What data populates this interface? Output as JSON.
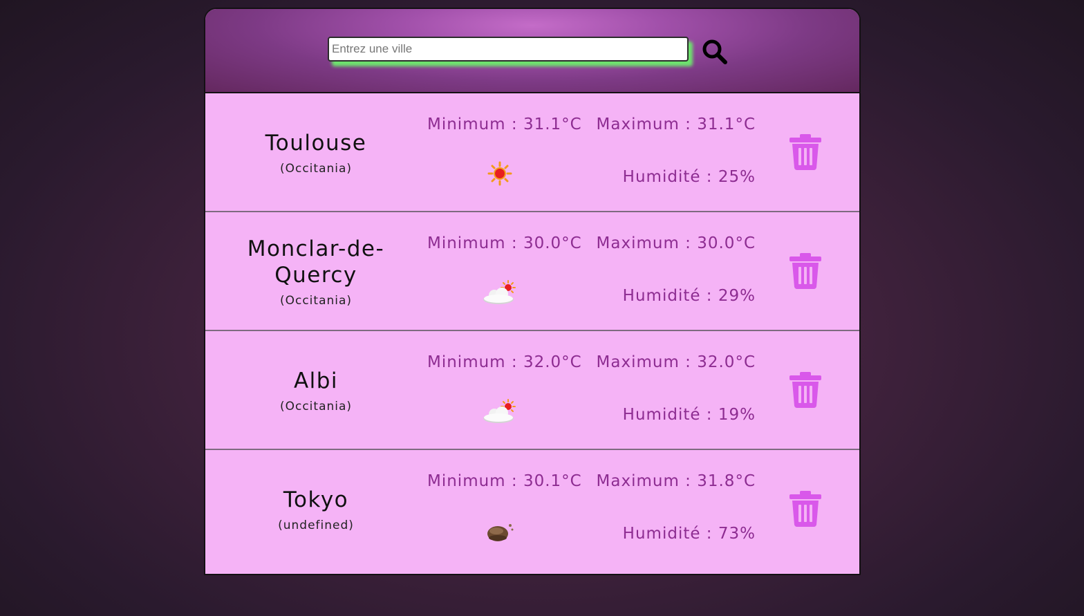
{
  "search": {
    "placeholder": "Entrez une ville",
    "value": ""
  },
  "colors": {
    "card_background": "#f5b3f6",
    "text_accent": "#8d2c91",
    "trash_icon": "#d958ea",
    "input_glow": "#6ee36e"
  },
  "cities": [
    {
      "name": "Toulouse",
      "region": "(Occitania)",
      "min": "Minimum : 31.1°C",
      "max": "Maximum : 31.1°C",
      "humidity": "Humidité : 25%",
      "icon": "sun-icon"
    },
    {
      "name": "Monclar-de-Quercy",
      "region": "(Occitania)",
      "min": "Minimum : 30.0°C",
      "max": "Maximum : 30.0°C",
      "humidity": "Humidité : 29%",
      "icon": "partly-cloudy-icon"
    },
    {
      "name": "Albi",
      "region": "(Occitania)",
      "min": "Minimum : 32.0°C",
      "max": "Maximum : 32.0°C",
      "humidity": "Humidité : 19%",
      "icon": "partly-cloudy-icon"
    },
    {
      "name": "Tokyo",
      "region": "(undefined)",
      "min": "Minimum : 30.1°C",
      "max": "Maximum : 31.8°C",
      "humidity": "Humidité : 73%",
      "icon": "dark-cloud-icon"
    }
  ]
}
